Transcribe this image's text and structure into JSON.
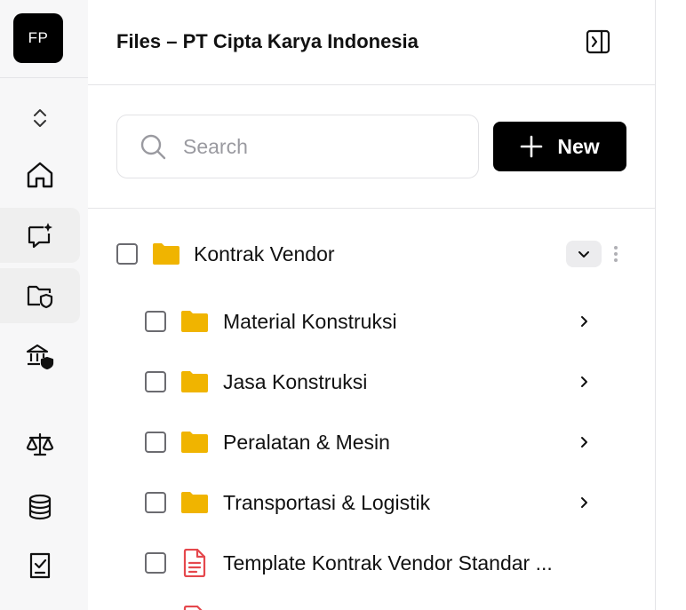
{
  "rail": {
    "avatar_initials": "FP",
    "items": [
      {
        "icon": "chevron-updown-icon"
      },
      {
        "icon": "home-icon"
      },
      {
        "icon": "chat-sparkle-icon",
        "active": true
      },
      {
        "icon": "folder-shield-icon",
        "active": true
      },
      {
        "icon": "bank-shield-icon"
      },
      {
        "icon": "scale-icon"
      },
      {
        "icon": "database-icon"
      },
      {
        "icon": "checklist-icon"
      }
    ]
  },
  "header": {
    "title": "Files – PT Cipta Karya Indonesia"
  },
  "toolbar": {
    "search_placeholder": "Search",
    "new_label": "New"
  },
  "tree": {
    "root": {
      "label": "Kontrak Vendor",
      "type": "folder",
      "expanded": true
    },
    "children": [
      {
        "label": "Material Konstruksi",
        "type": "folder"
      },
      {
        "label": "Jasa Konstruksi",
        "type": "folder"
      },
      {
        "label": "Peralatan & Mesin",
        "type": "folder"
      },
      {
        "label": "Transportasi & Logistik",
        "type": "folder"
      },
      {
        "label": "Template Kontrak Vendor Standar ...",
        "type": "file"
      }
    ]
  },
  "colors": {
    "folder": "#f0b400",
    "file": "#e5484d",
    "primary": "#000000",
    "rail_bg": "#f7f7f8",
    "border": "#e4e4e7"
  }
}
